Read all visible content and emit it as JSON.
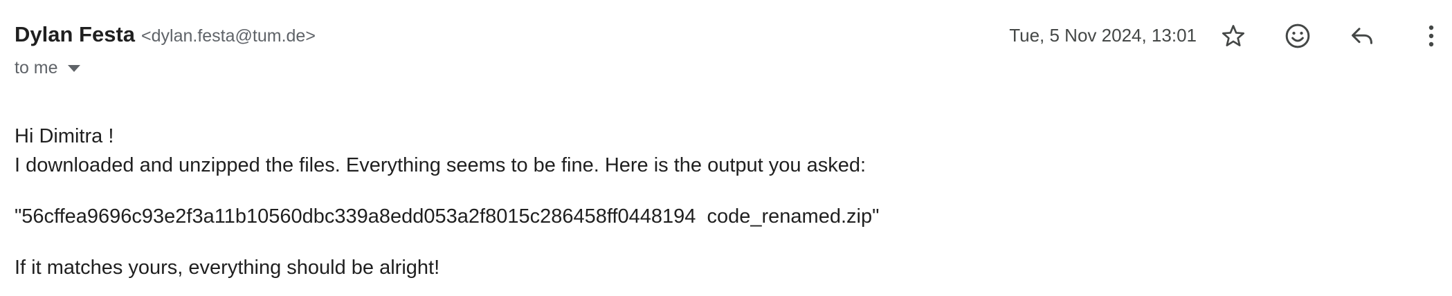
{
  "message": {
    "sender_name": "Dylan Festa",
    "sender_email": "<dylan.festa@tum.de>",
    "recipient": "to me",
    "timestamp": "Tue, 5 Nov 2024, 13:01"
  },
  "actions": {
    "star_icon": "star-outline",
    "emoji_icon": "emoji-reaction",
    "reply_icon": "reply-arrow",
    "more_icon": "more-vertical"
  },
  "body": {
    "greeting": "Hi Dimitra !",
    "line1": "I downloaded and unzipped the files. Everything seems to be fine. Here is the output you asked:",
    "checksum": "\"56cffea9696c93e2f3a11b10560dbc339a8edd053a2f8015c286458ff0448194  code_renamed.zip\"",
    "closing": "If it matches yours, everything should be alright!"
  },
  "colors": {
    "text_primary": "#1f1f1f",
    "text_secondary": "#5f6368",
    "icon": "#444746"
  }
}
